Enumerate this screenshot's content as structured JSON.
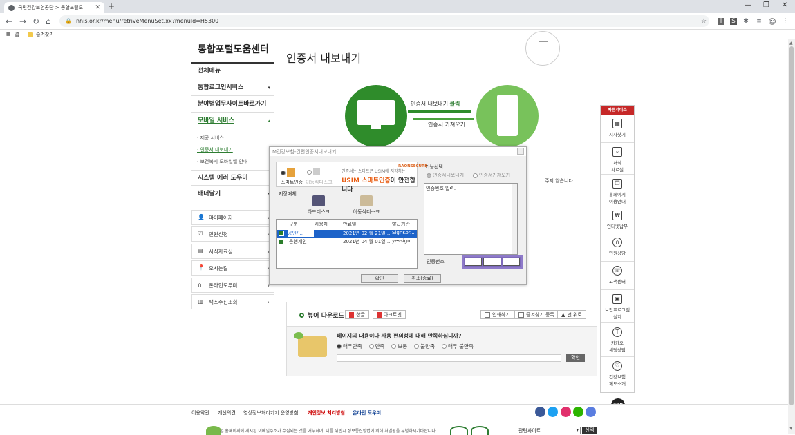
{
  "browser": {
    "tab_title": "국민건강보험공단 > 통합포털도",
    "url": "nhis.or.kr/menu/retriveMenuSet.xx?menuId=H5300",
    "bookmarks_apps": "앱",
    "bookmark_folder": "즐겨찾기"
  },
  "lnb": {
    "title": "통합포털도움센터",
    "items": [
      {
        "label": "전체메뉴",
        "arrow": ""
      },
      {
        "label": "통합로그인서비스",
        "arrow": "▾"
      },
      {
        "label": "분야별업무사이트바로가기",
        "arrow": ""
      },
      {
        "label": "모바일 서비스",
        "arrow": "▴"
      },
      {
        "label": "시스템 에러 도우미",
        "arrow": ""
      },
      {
        "label": "배너달기",
        "arrow": "▾"
      }
    ],
    "subitems": [
      "제공 서비스",
      "인증서 내보내기",
      "보건복지 모바일앱 안내"
    ],
    "quick": [
      {
        "label": "마이페이지",
        "icon": "person-icon",
        "glyph": "👤"
      },
      {
        "label": "민원신청",
        "icon": "form-icon",
        "glyph": "☑"
      },
      {
        "label": "서식자료실",
        "icon": "doc-icon",
        "glyph": "▤"
      },
      {
        "label": "오시는길",
        "icon": "pin-icon",
        "glyph": "📍"
      },
      {
        "label": "온라인도우미",
        "icon": "headset-icon",
        "glyph": "∩"
      },
      {
        "label": "팩스수신조회",
        "icon": "fax-icon",
        "glyph": "▥"
      }
    ]
  },
  "content": {
    "title": "인증서 내보내기",
    "flow_right": "인증서 내보내기",
    "flow_right_bold": "클릭",
    "flow_left": "인증서 가져오기",
    "note": "주지 않습니다."
  },
  "dialog": {
    "title": "M건강보험-간편인증서내보내기",
    "tab_smart": "스마트인증",
    "tab_removable": "이동식디스크",
    "brand_desc": "인증서는 스마트폰 USIM에 저장하는",
    "usim_highlight": "USIM 스마트인증",
    "usim_rest": "이 안전합니다",
    "raon": "RAONSECURE",
    "storage_label": "저장매체",
    "drive_hard": "하드디스크",
    "drive_removable": "이동식디스크",
    "list_headers": [
      "구분",
      "사용자",
      "만료일",
      "발급기관"
    ],
    "list_rows": [
      {
        "type": "공인/...",
        "user": "",
        "expiry": "2021년 02 월 21일 ...",
        "issuer": "SignKor..."
      },
      {
        "type": "은행개인",
        "user": "",
        "expiry": "2021년 04 월 01일 ...",
        "issuer": "yessign..."
      }
    ],
    "function_label": "기능선택",
    "func_export": "인증서내보내기",
    "func_import": "인증서가져오기",
    "textarea": "인증번호 입력.",
    "pin_label": "인증번호",
    "ok": "확인",
    "cancel": "취소(종료)"
  },
  "viewer": {
    "download_label": "뷰어 다운로드",
    "hangul": "한글",
    "acrobat": "아크로벳",
    "print": "인쇄하기",
    "favorite": "즐겨찾기 등록",
    "top": "맨 위로",
    "question": "페이지의 내용이나 사용 편의성에 대해 만족하십니까?",
    "options": [
      "매우만족",
      "만족",
      "보통",
      "불만족",
      "매우 불만족"
    ],
    "submit": "확인"
  },
  "quickmenu": {
    "title": "빠른서비스",
    "items": [
      {
        "label": "지사찾기",
        "icon": "building-icon",
        "glyph": "▦"
      },
      {
        "label": "서식\n자료실",
        "icon": "search-doc-icon",
        "glyph": "⌕"
      },
      {
        "label": "홈페이지\n이용안내",
        "icon": "copy-icon",
        "glyph": "❐"
      },
      {
        "label": "인터넷납부",
        "icon": "monitor-icon",
        "glyph": "₩"
      },
      {
        "label": "민원상담",
        "icon": "headset-icon",
        "glyph": "∩"
      },
      {
        "label": "고객센터",
        "icon": "phone-icon",
        "glyph": "☏"
      },
      {
        "label": "보안프로그램\n설치",
        "icon": "security-icon",
        "glyph": "▣"
      },
      {
        "label": "카카오\n채팅상담",
        "icon": "kakao-icon",
        "glyph": "T"
      },
      {
        "label": "건강보험\n제도소개",
        "icon": "heart-icon",
        "glyph": "♡"
      }
    ],
    "top": "TOP"
  },
  "footer": {
    "links": [
      "이용약관",
      "개선의견",
      "영상정보처리기기 운영방침",
      "개인정보 처리방침",
      "온라인 도우미"
    ],
    "copyright": "본 홈페이지에 게시된 이메일주소가 수집되는 것을 거부하며, 이를 위반시 정보통신망법에 의해 처벌됨을 유념하시기바랍니다.",
    "related_site": "관련사이트",
    "go": "선택",
    "sns_colors": [
      "#3b5998",
      "#1da1f2",
      "#e1306c",
      "#2db400",
      "#5a7de0"
    ]
  }
}
